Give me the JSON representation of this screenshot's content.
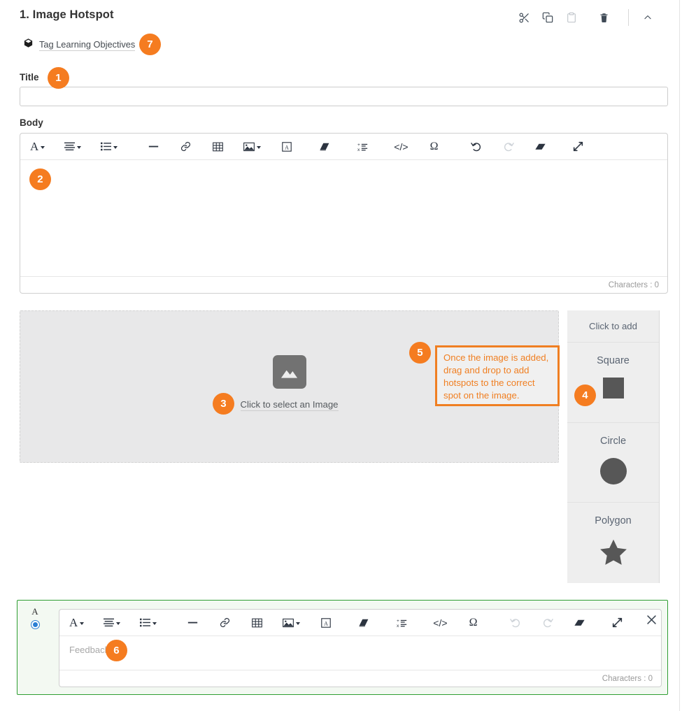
{
  "header": {
    "question_title": "1. Image Hotspot",
    "tools": [
      {
        "name": "cut-icon",
        "label": "Cut"
      },
      {
        "name": "copy-icon",
        "label": "Copy"
      },
      {
        "name": "paste-icon",
        "label": "Paste"
      },
      {
        "name": "delete-icon",
        "label": "Delete"
      },
      {
        "name": "collapse-icon",
        "label": "Collapse"
      }
    ]
  },
  "tag_learning_objectives": {
    "label": "Tag Learning Objectives",
    "icon": "cube-icon"
  },
  "title_field": {
    "label": "Title",
    "value": "",
    "placeholder": ""
  },
  "body_field": {
    "label": "Body",
    "value": "",
    "placeholder": "",
    "character_count": "Characters : 0"
  },
  "rte_toolbar": {
    "buttons": [
      {
        "name": "font-style-icon",
        "label": "A",
        "has_caret": true,
        "disabled": false
      },
      {
        "name": "align-icon",
        "label": "",
        "has_caret": true,
        "disabled": false
      },
      {
        "name": "list-icon",
        "label": "",
        "has_caret": true,
        "disabled": false
      },
      {
        "name": "horizontal-rule-icon",
        "label": "",
        "has_caret": false,
        "disabled": false
      },
      {
        "name": "link-icon",
        "label": "",
        "has_caret": false,
        "disabled": false
      },
      {
        "name": "table-icon",
        "label": "",
        "has_caret": false,
        "disabled": false
      },
      {
        "name": "image-icon",
        "label": "",
        "has_caret": true,
        "disabled": false
      },
      {
        "name": "text-box-icon",
        "label": "",
        "has_caret": false,
        "disabled": false
      },
      {
        "name": "book-icon",
        "label": "",
        "has_caret": false,
        "disabled": false
      },
      {
        "name": "equation-icon",
        "label": "",
        "has_caret": false,
        "disabled": false
      },
      {
        "name": "source-code-icon",
        "label": "",
        "has_caret": false,
        "disabled": false
      },
      {
        "name": "special-character-icon",
        "label": "Ω",
        "has_caret": false,
        "disabled": false
      },
      {
        "name": "undo-icon",
        "label": "",
        "has_caret": false,
        "disabled": false
      },
      {
        "name": "redo-icon",
        "label": "",
        "has_caret": false,
        "disabled": true
      },
      {
        "name": "clear-format-icon",
        "label": "",
        "has_caret": false,
        "disabled": false
      },
      {
        "name": "fullscreen-icon",
        "label": "",
        "has_caret": false,
        "disabled": false
      }
    ],
    "omega": "Ω",
    "code": "</>",
    "font_letter": "A"
  },
  "dropzone": {
    "icon": "image-placeholder-icon",
    "label": "Click to select an Image"
  },
  "callout": {
    "text": "Once the image is added, drag and drop to add hotspots to the correct spot on the image.",
    "color": "#f07f22"
  },
  "shapes_panel": {
    "header": "Click to add",
    "items": [
      {
        "name": "square",
        "label": "Square",
        "shape": "square-shape"
      },
      {
        "name": "circle",
        "label": "Circle",
        "shape": "circle-shape"
      },
      {
        "name": "polygon",
        "label": "Polygon",
        "shape": "star-shape"
      }
    ]
  },
  "feedback": {
    "choice_letter": "A",
    "radio_selected": true,
    "placeholder": "Feedback",
    "character_count": "Characters : 0",
    "close_label": "Close",
    "border_color": "#2e9e32"
  },
  "badges": {
    "b1": "1",
    "b2": "2",
    "b3": "3",
    "b4": "4",
    "b5": "5",
    "b6": "6",
    "b7": "7",
    "color": "#f57c20"
  }
}
